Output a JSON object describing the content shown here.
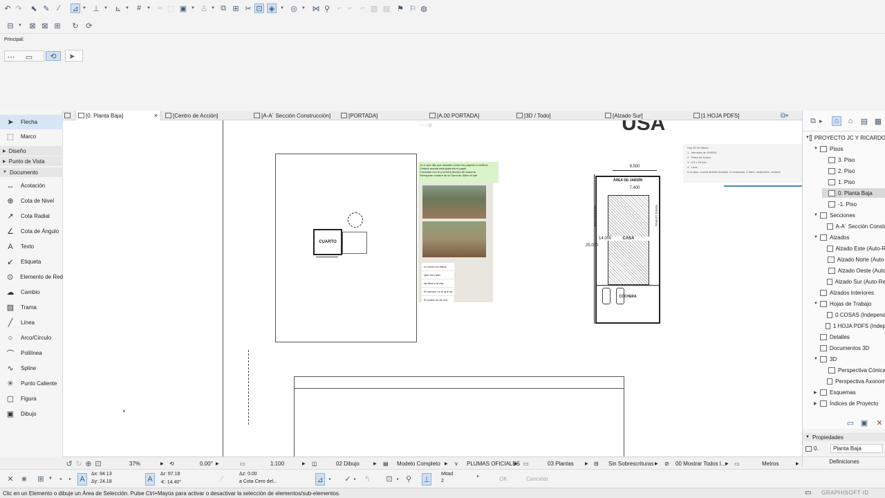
{
  "infobox": {
    "label": "Principal:"
  },
  "toolbox": {
    "top_tools": [
      {
        "label": "Flecha",
        "icon": "arrow-icon"
      },
      {
        "label": "Marco",
        "icon": "marquee-icon"
      }
    ],
    "groups": [
      {
        "label": "Diseño",
        "expanded": false
      },
      {
        "label": "Punto de Vista",
        "expanded": false
      },
      {
        "label": "Documento",
        "expanded": true
      }
    ],
    "document_tools": [
      {
        "label": "Acotación",
        "icon": "dimension-icon"
      },
      {
        "label": "Cota de Nivel",
        "icon": "level-dimension-icon"
      },
      {
        "label": "Cota Radial",
        "icon": "radial-dimension-icon"
      },
      {
        "label": "Cota de Ángulo",
        "icon": "angle-dimension-icon"
      },
      {
        "label": "Texto",
        "icon": "text-icon"
      },
      {
        "label": "Etiqueta",
        "icon": "label-icon"
      },
      {
        "label": "Elemento de Red",
        "icon": "grid-element-icon"
      },
      {
        "label": "Cambio",
        "icon": "change-icon"
      },
      {
        "label": "Trama",
        "icon": "fill-icon"
      },
      {
        "label": "Línea",
        "icon": "line-icon"
      },
      {
        "label": "Arco/Círculo",
        "icon": "arc-icon"
      },
      {
        "label": "Polilínea",
        "icon": "polyline-icon"
      },
      {
        "label": "Spline",
        "icon": "spline-icon"
      },
      {
        "label": "Punto Caliente",
        "icon": "hotspot-icon"
      },
      {
        "label": "Figura",
        "icon": "figure-icon"
      },
      {
        "label": "Dibujo",
        "icon": "drawing-icon"
      }
    ]
  },
  "tabs": [
    {
      "label": "[0. Planta Baja]",
      "active": true
    },
    {
      "label": "[Centro de Acción]"
    },
    {
      "label": "[A-A´ Sección Construcción]"
    },
    {
      "label": "[PORTADA]"
    },
    {
      "label": "[A.00 PORTADA]"
    },
    {
      "label": "[3D / Todo]"
    },
    {
      "label": "[Alzado Sur]"
    },
    {
      "label": "[1 HOJA PDFS]"
    }
  ],
  "canvas": {
    "title_partial": "USA",
    "room_label": "CUARTO",
    "site": {
      "area_label": "ÁREA DE JARDÍN",
      "house_label": "CASA",
      "garage_label": "COCHERA",
      "dim_top_outer": "9.500",
      "dim_top_inner": "7.400",
      "dim_left_total": "25.000",
      "dim_left_house": "14.000",
      "side_label_left": "PARED LATERAL",
      "side_label_right": "PARED LATERAL"
    },
    "chat_header": "Yo lo que dijo que mandes, todos los papeles a verificar",
    "chat_lines": [
      "Cristina aranda está pidiendo el papel",
      "Consultar con el y la ficha tecnica de Aracena",
      "Semejante nombre de la Tierra de 300m el lote"
    ],
    "chat_messages": [
      "Le envío los datos",
      "Qué me pidió",
      "los fitos a la cita",
      "El número no lo que ha",
      "El cuarto es de 4x4"
    ],
    "note_lines": [
      "Hoy 30 de Marzo",
      "1 - Memoria de GURSA",
      "2 - Plaza de Acuña",
      "3 - A 5 x 25 mts",
      "4 - Loza",
      "5 un piso, cocina abierta techada, 3 recamaras, 1 baño, lavandería, cochera"
    ]
  },
  "navigator": {
    "top_icons": [
      "project-map-icon",
      "view-map-icon",
      "layout-book-icon",
      "publisher-icon"
    ],
    "items": [
      {
        "label": "PROYECTO JC Y RICARDO",
        "level": 0,
        "toggle": "v"
      },
      {
        "label": "Pisos",
        "level": 1,
        "toggle": "v"
      },
      {
        "label": "3. Piso",
        "level": 2
      },
      {
        "label": "2. Piso",
        "level": 2
      },
      {
        "label": "1. Piso",
        "level": 2
      },
      {
        "label": "0. Planta Baja",
        "level": 2,
        "selected": true
      },
      {
        "label": "-1. Piso",
        "level": 2
      },
      {
        "label": "Secciones",
        "level": 1,
        "toggle": "v"
      },
      {
        "label": "A-A´ Sección Constr",
        "level": 2
      },
      {
        "label": "Alzados",
        "level": 1,
        "toggle": "v"
      },
      {
        "label": "Alzado Este (Auto-R",
        "level": 2
      },
      {
        "label": "Alzado Norte (Auto-",
        "level": 2
      },
      {
        "label": "Alzado Oeste (Auto",
        "level": 2
      },
      {
        "label": "Alzado Sur (Auto-Re",
        "level": 2
      },
      {
        "label": "Alzados Interiores",
        "level": 1
      },
      {
        "label": "Hojas de Trabajo",
        "level": 1,
        "toggle": "v"
      },
      {
        "label": "0 COSAS (Independ",
        "level": 2
      },
      {
        "label": "1 HOJA PDFS (Indep",
        "level": 2
      },
      {
        "label": "Detalles",
        "level": 1
      },
      {
        "label": "Documentos 3D",
        "level": 1
      },
      {
        "label": "3D",
        "level": 1,
        "toggle": "v"
      },
      {
        "label": "Perspectiva Cónica",
        "level": 2
      },
      {
        "label": "Perspectiva Axonom",
        "level": 2
      },
      {
        "label": "Esquemas",
        "level": 1,
        "toggle": ">"
      },
      {
        "label": "Índices de Proyecto",
        "level": 1,
        "toggle": ">"
      }
    ]
  },
  "properties": {
    "title": "Propiedades",
    "id": "0.",
    "name": "Planta Baja",
    "button": "Definiciones"
  },
  "statusbar": {
    "zoom": "37%",
    "angle": "0.00°",
    "scale": "1:100",
    "layer_combo": "02 Dibujo",
    "model_view": "Modelo Completo",
    "pens": "PLUMAS OFICIALES",
    "plan_type": "03 Plantas",
    "overrides": "Sin Sobrescrituras",
    "renovation": "00 Mostrar Todos l...",
    "units": "Metros"
  },
  "bottombar": {
    "dx": "Δx: 94.13",
    "dy": "Δy: 24.18",
    "dr": "Δr: 97.18",
    "da": "∢: 14.40°",
    "dz": "Δz: 0.00",
    "ref": "a Cota Cero del...",
    "snap_label": "Mitad",
    "snap_value": "2",
    "ok": "OK",
    "cancel": "Cancelar"
  },
  "hint": "Clic en un Elemento o dibuje un Área de Selección. Pulse Ctrl+Mayús para activar o desactivar la selección de elementos/sub-elementos.",
  "brand": "GRAPHISOFT ID"
}
